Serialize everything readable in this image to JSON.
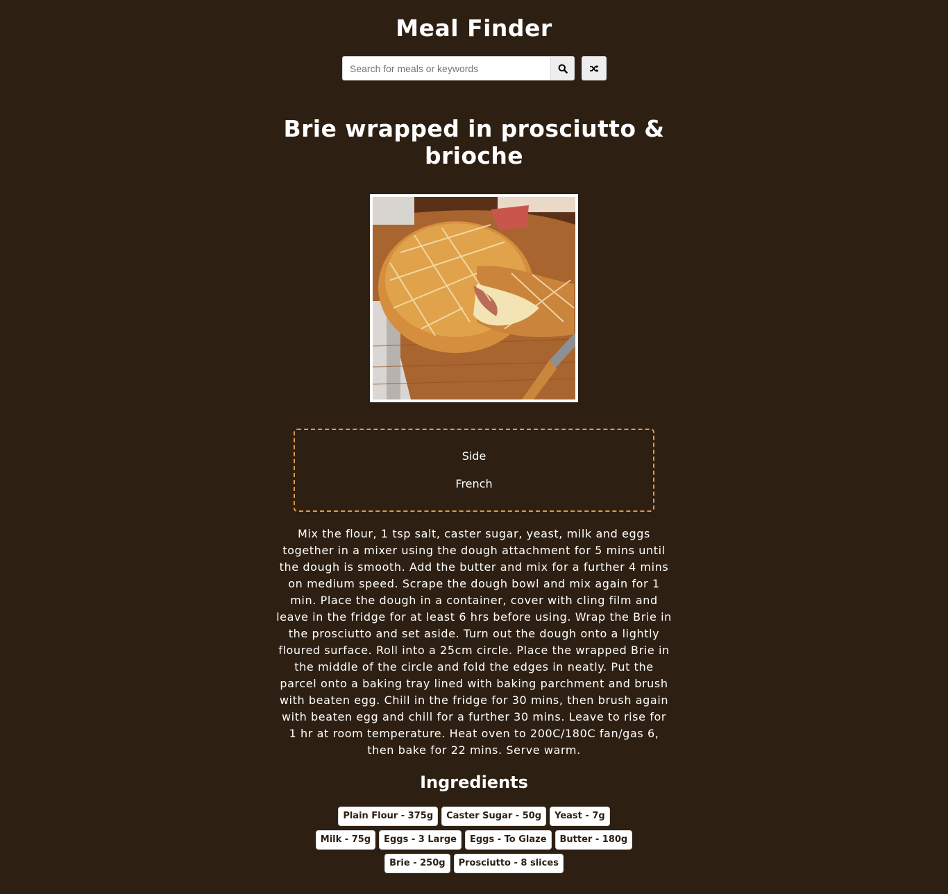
{
  "app": {
    "title": "Meal Finder"
  },
  "search": {
    "placeholder": "Search for meals or keywords",
    "value": "",
    "search_icon": "search-icon",
    "random_icon": "shuffle-icon"
  },
  "meal": {
    "title": "Brie wrapped in prosciutto & brioche",
    "category": "Side",
    "area": "French",
    "instructions": "Mix the flour, 1 tsp salt, caster sugar, yeast, milk and eggs together in a mixer using the dough attachment for 5 mins until the dough is smooth. Add the butter and mix for a further 4 mins on medium speed. Scrape the dough bowl and mix again for 1 min. Place the dough in a container, cover with cling film and leave in the fridge for at least 6 hrs before using. Wrap the Brie in the prosciutto and set aside. Turn out the dough onto a lightly floured surface. Roll into a 25cm circle. Place the wrapped Brie in the middle of the circle and fold the edges in neatly. Put the parcel onto a baking tray lined with baking parchment and brush with beaten egg. Chill in the fridge for 30 mins, then brush again with beaten egg and chill for a further 30 mins. Leave to rise for 1 hr at room temperature. Heat oven to 200C/180C fan/gas 6, then bake for 22 mins. Serve warm.",
    "ingredients_title": "Ingredients",
    "ingredients": [
      "Plain Flour - 375g",
      "Caster Sugar - 50g",
      "Yeast - 7g",
      "Milk - 75g",
      "Eggs - 3 Large",
      "Eggs - To Glaze",
      "Butter - 180g",
      "Brie - 250g",
      "Prosciutto - 8 slices"
    ]
  },
  "colors": {
    "background": "#2d2013",
    "text": "#ffffff",
    "info_border": "#e09850",
    "button_bg": "#eeeeee"
  }
}
